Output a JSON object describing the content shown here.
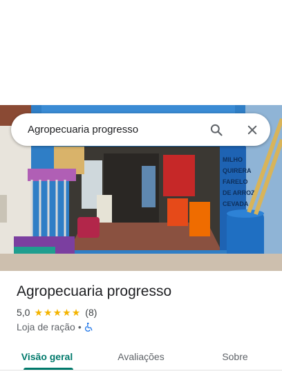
{
  "search": {
    "value": "Agropecuaria progresso",
    "icons": {
      "search": "search-icon",
      "clear": "close-icon"
    }
  },
  "photo": {
    "storefront_lettering": [
      "MILHO",
      "QUIRERA",
      "FARELO",
      "DE ARROZ",
      "CEVADA"
    ]
  },
  "place": {
    "name": "Agropecuaria progresso",
    "rating": "5,0",
    "stars": 5,
    "review_count": "(8)",
    "category": "Loja de ração",
    "separator": "•",
    "accessibility_icon": "wheelchair-icon"
  },
  "tabs": [
    {
      "label": "Visão geral",
      "active": true
    },
    {
      "label": "Avaliações",
      "active": false
    },
    {
      "label": "Sobre",
      "active": false
    }
  ],
  "colors": {
    "accent": "#00796b",
    "star": "#f4b400",
    "wheelchair": "#1a73e8"
  }
}
